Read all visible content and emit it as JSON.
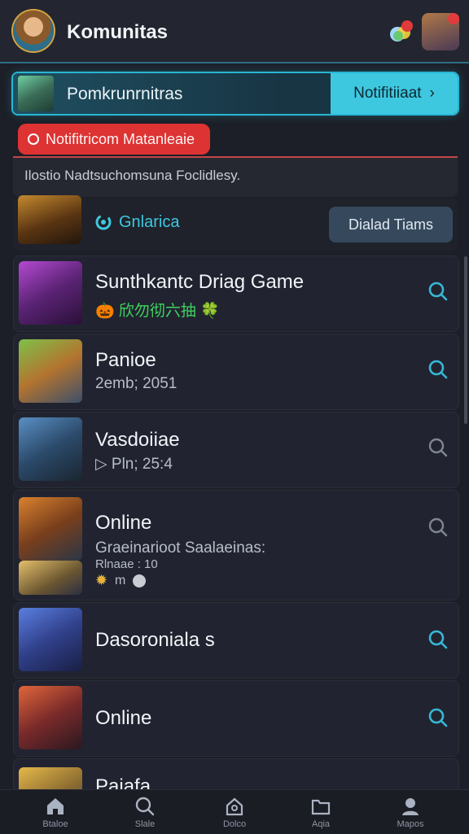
{
  "header": {
    "title": "Komunitas"
  },
  "banner": {
    "title": "Pomkrunrnitras",
    "button_label": "Notifitiiaat",
    "button_chevron": "›"
  },
  "alert": {
    "label": "Notifitricom Matanleaie"
  },
  "info": {
    "text": "Ilostio Nadtsuchomsuna Foclidlesy."
  },
  "featured": {
    "name": "Gnlarica",
    "button_label": "Dialad Tiams"
  },
  "games": [
    {
      "title": "Sunthkantc Driag Game",
      "subtitle": "🎃 欣勿彻六抽 🍀"
    },
    {
      "title": "Panioe",
      "subtitle": "2emb; 2051"
    },
    {
      "title": "Vasdoiiae",
      "subtitle": "▷ Pln; 25:4"
    },
    {
      "title": "Online",
      "subtitle": "Graeinarioot Saalaeinas:",
      "extra": "Rlnaae : 10",
      "extra2": "m"
    },
    {
      "title": "Dasoroniala s",
      "subtitle": ""
    },
    {
      "title": "Online",
      "subtitle": ""
    },
    {
      "title": "Pajafa",
      "subtitle": ""
    }
  ],
  "nav": [
    {
      "label": "Btaloe",
      "icon": "home-icon"
    },
    {
      "label": "Slale",
      "icon": "search-icon"
    },
    {
      "label": "Dolco",
      "icon": "house-alt-icon"
    },
    {
      "label": "Aqia",
      "icon": "folder-icon"
    },
    {
      "label": "Mapos",
      "icon": "profile-icon"
    }
  ],
  "colors": {
    "accent": "#3ec8e0",
    "alert": "#dd3333",
    "background": "#1c1f27"
  }
}
